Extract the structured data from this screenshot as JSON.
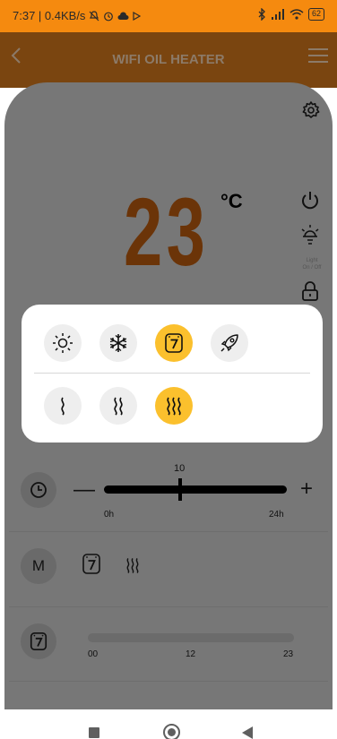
{
  "status_bar": {
    "time_speed": "7:37 | 0.4KB/s",
    "battery": "62"
  },
  "app_bar": {
    "title": "WIFI OIL HEATER",
    "back_icon": "chevron-left-icon",
    "menu_icon": "hamburger-menu-icon"
  },
  "display": {
    "temperature": "23",
    "unit": "°C",
    "light_label_line1": "Light",
    "light_label_line2": "On / Off"
  },
  "mode_popup": {
    "modes": [
      {
        "icon": "sun-icon",
        "active": false
      },
      {
        "icon": "snowflake-icon",
        "active": false
      },
      {
        "icon": "preset-7-icon",
        "active": true
      },
      {
        "icon": "rocket-icon",
        "active": false
      }
    ],
    "heat_levels": [
      {
        "icon": "heat-level-1-icon",
        "active": false
      },
      {
        "icon": "heat-level-2-icon",
        "active": false
      },
      {
        "icon": "heat-level-3-icon",
        "active": true
      }
    ]
  },
  "timer": {
    "value": "10",
    "min_label": "0h",
    "max_label": "24h",
    "minus": "—",
    "plus": "+"
  },
  "mode_row": {
    "label": "M"
  },
  "schedule": {
    "ticks": [
      "00",
      "12",
      "23"
    ]
  },
  "colors": {
    "accent": "#f58a0f",
    "temperature": "#6b3408",
    "active_option": "#fbc02d",
    "overlay": "#777777"
  }
}
